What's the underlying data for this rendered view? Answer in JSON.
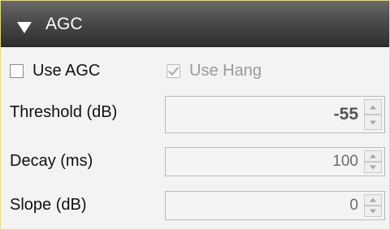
{
  "header": {
    "title": "AGC"
  },
  "options": {
    "use_agc_label": "Use AGC",
    "use_hang_label": "Use Hang"
  },
  "fields": [
    {
      "label": "Threshold (dB)",
      "value": "-55"
    },
    {
      "label": "Decay (ms)",
      "value": "100"
    },
    {
      "label": "Slope (dB)",
      "value": "0"
    }
  ]
}
